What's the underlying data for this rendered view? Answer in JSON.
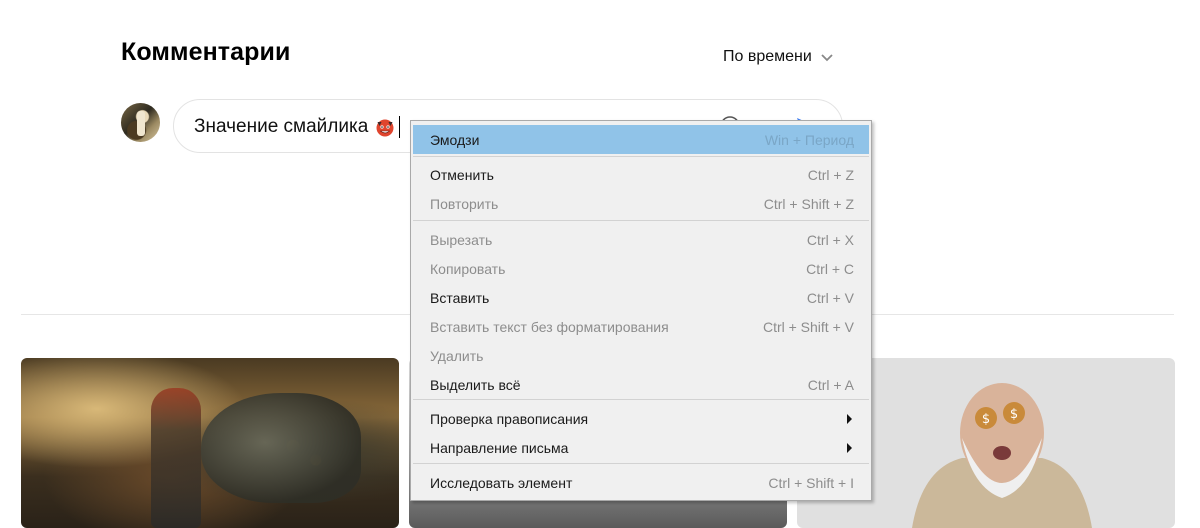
{
  "comments": {
    "title": "Комментарии",
    "sort_label": "По времени"
  },
  "composer": {
    "text": "Значение смайлика",
    "emoji_name": "devil-face-emoji",
    "icons": [
      "smile-icon",
      "camera-icon",
      "send-icon"
    ]
  },
  "context_menu": {
    "items": [
      {
        "label": "Эмодзи",
        "shortcut": "Win + Период",
        "state": "highlighted"
      },
      {
        "label": "Отменить",
        "shortcut": "Ctrl + Z",
        "state": "enabled"
      },
      {
        "label": "Повторить",
        "shortcut": "Ctrl + Shift + Z",
        "state": "disabled"
      },
      {
        "label": "Вырезать",
        "shortcut": "Ctrl + X",
        "state": "disabled"
      },
      {
        "label": "Копировать",
        "shortcut": "Ctrl + C",
        "state": "disabled"
      },
      {
        "label": "Вставить",
        "shortcut": "Ctrl + V",
        "state": "enabled"
      },
      {
        "label": "Вставить текст без форматирования",
        "shortcut": "Ctrl + Shift + V",
        "state": "disabled"
      },
      {
        "label": "Удалить",
        "shortcut": "",
        "state": "disabled"
      },
      {
        "label": "Выделить всё",
        "shortcut": "Ctrl + A",
        "state": "enabled"
      },
      {
        "label": "Проверка правописания",
        "shortcut": "",
        "state": "submenu"
      },
      {
        "label": "Направление письма",
        "shortcut": "",
        "state": "submenu"
      },
      {
        "label": "Исследовать элемент",
        "shortcut": "Ctrl + Shift + I",
        "state": "enabled"
      }
    ],
    "highlight_color": "#90c3e8"
  },
  "colors": {
    "accent": "#3d7cf0",
    "menu_bg": "#f0f0f0"
  }
}
